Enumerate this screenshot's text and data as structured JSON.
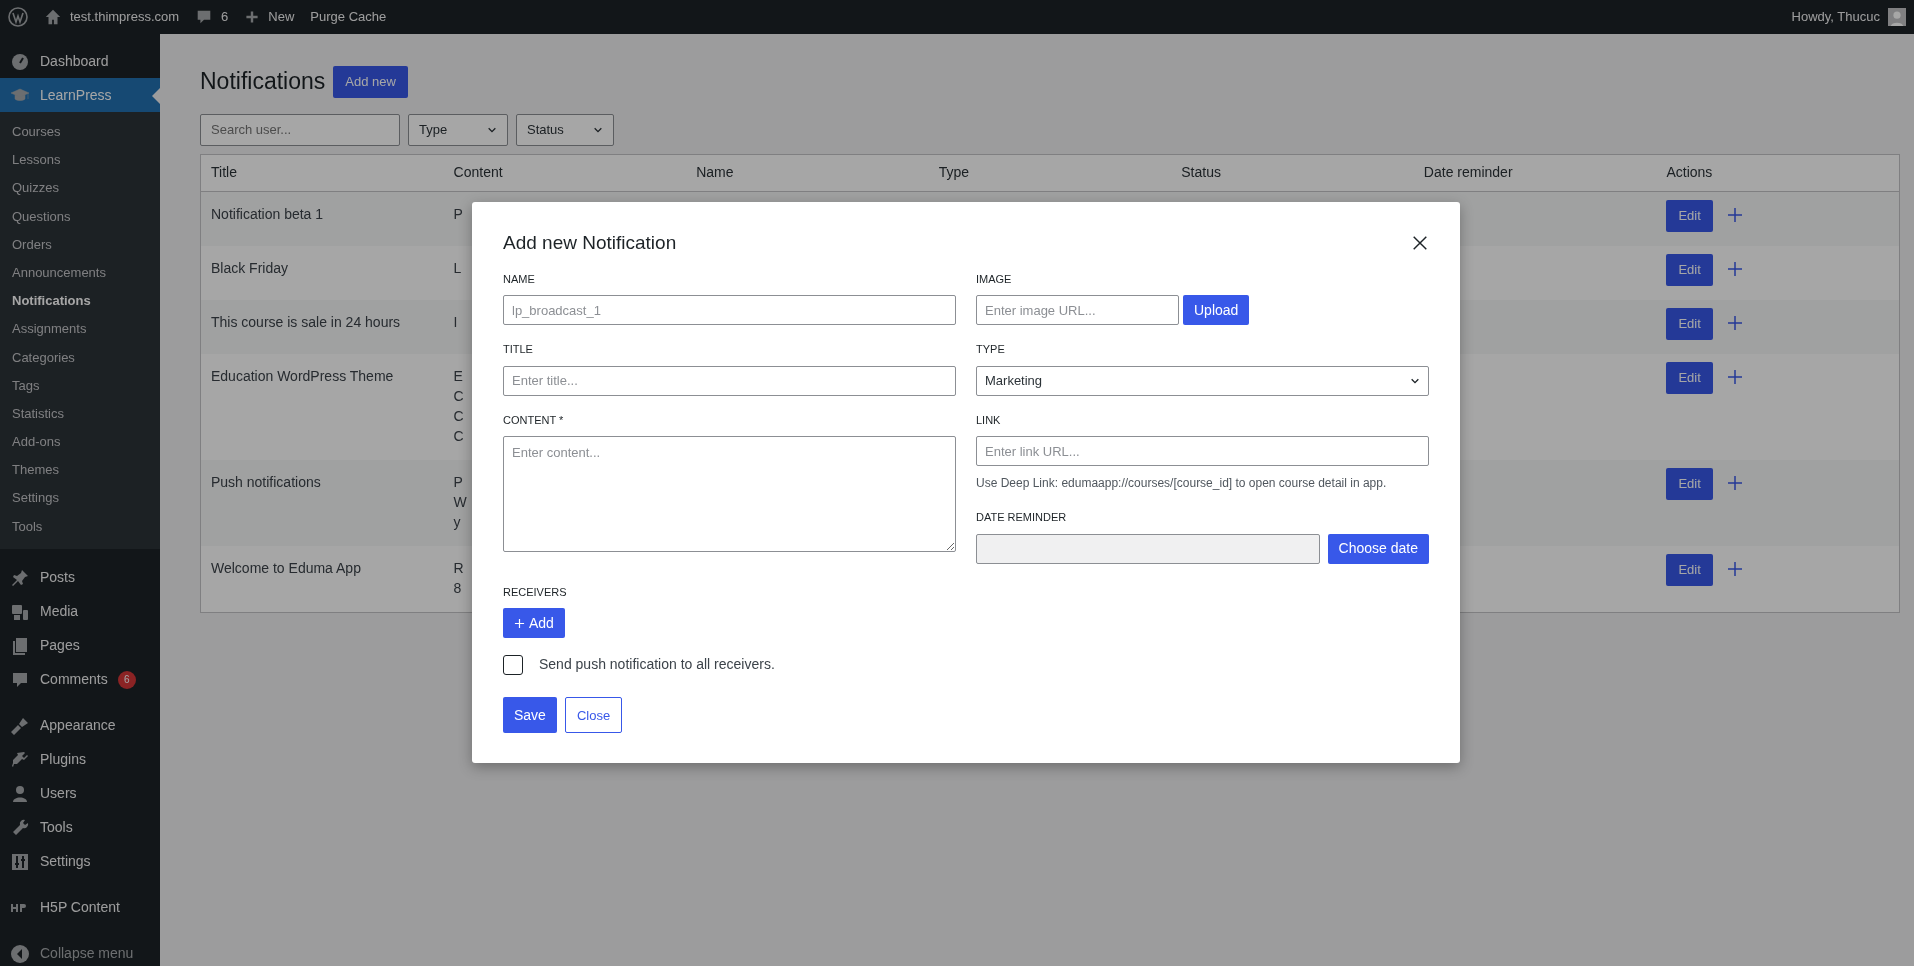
{
  "admin_bar": {
    "site": "test.thimpress.com",
    "comments": "6",
    "new": "New",
    "items": [
      "Purge Cache"
    ],
    "greeting": "Howdy, Thucuc"
  },
  "sidebar": {
    "groups": [
      [
        {
          "label": "Dashboard",
          "selected": false
        },
        {
          "label": "LearnPress",
          "selected": true,
          "children": [
            {
              "label": "Courses",
              "selected": false
            },
            {
              "label": "Lessons",
              "selected": false
            },
            {
              "label": "Quizzes",
              "selected": false
            },
            {
              "label": "Questions",
              "selected": false
            },
            {
              "label": "Orders",
              "selected": false
            },
            {
              "label": "Announcements",
              "selected": false
            },
            {
              "label": "Notifications",
              "selected": true
            },
            {
              "label": "Assignments",
              "selected": false
            },
            {
              "label": "Categories",
              "selected": false
            },
            {
              "label": "Tags",
              "selected": false
            },
            {
              "label": "Statistics",
              "selected": false
            },
            {
              "label": "Add-ons",
              "selected": false
            },
            {
              "label": "Themes",
              "selected": false
            },
            {
              "label": "Settings",
              "selected": false
            },
            {
              "label": "Tools",
              "selected": false
            }
          ]
        }
      ],
      [
        {
          "label": "Posts",
          "selected": false
        },
        {
          "label": "Media",
          "selected": false
        },
        {
          "label": "Pages",
          "selected": false
        },
        {
          "label": "Comments",
          "selected": false,
          "badge": "6"
        }
      ],
      [
        {
          "label": "Appearance",
          "selected": false
        },
        {
          "label": "Plugins",
          "selected": false
        },
        {
          "label": "Users",
          "selected": false
        },
        {
          "label": "Tools",
          "selected": false
        },
        {
          "label": "Settings",
          "selected": false
        }
      ],
      [
        {
          "label": "H5P Content",
          "selected": false
        }
      ]
    ],
    "collapse": "Collapse menu"
  },
  "page": {
    "title": "Notifications",
    "add_button": "Add new",
    "search": {
      "placeholder": "Search user..."
    },
    "filters": [
      "Type",
      "Status"
    ]
  },
  "table": {
    "columns": [
      "Title",
      "Content",
      "Name",
      "Type",
      "Status",
      "Date reminder",
      "Actions"
    ],
    "rows": [
      {
        "title": "Notification beta 1",
        "content": [
          "P"
        ],
        "edit": "Edit"
      },
      {
        "title": "Black Friday",
        "content": [
          "L"
        ],
        "edit": "Edit"
      },
      {
        "title": "This course is sale in 24 hours",
        "content": [
          "I"
        ],
        "edit": "Edit"
      },
      {
        "title": "Education WordPress Theme",
        "content": [
          "E",
          "C",
          "C",
          "C"
        ],
        "edit": "Edit"
      },
      {
        "title": "Push notifications",
        "content": [
          "P",
          "W",
          "y"
        ],
        "edit": "Edit"
      },
      {
        "title": "Welcome to Eduma App",
        "content": [
          "R",
          "8"
        ],
        "edit": "Edit"
      }
    ]
  },
  "modal": {
    "title": "Add new Notification",
    "name": {
      "label": "NAME",
      "placeholder": "lp_broadcast_1"
    },
    "title_field": {
      "label": "TITLE",
      "placeholder": "Enter title..."
    },
    "content": {
      "label": "CONTENT *",
      "placeholder": "Enter content..."
    },
    "image": {
      "label": "IMAGE",
      "placeholder": "Enter image URL...",
      "button": "Upload"
    },
    "type": {
      "label": "TYPE",
      "value": "Marketing"
    },
    "link": {
      "label": "LINK",
      "placeholder": "Enter link URL...",
      "help": "Use Deep Link: edumaapp://courses/[course_id] to open course detail in app."
    },
    "date_reminder": {
      "label": "DATE REMINDER",
      "button": "Choose date"
    },
    "receivers": {
      "label": "RECEIVERS",
      "button": "Add"
    },
    "push_all": {
      "label": "Send push notification to all receivers.",
      "checked": false
    },
    "save": "Save",
    "close": "Close"
  }
}
